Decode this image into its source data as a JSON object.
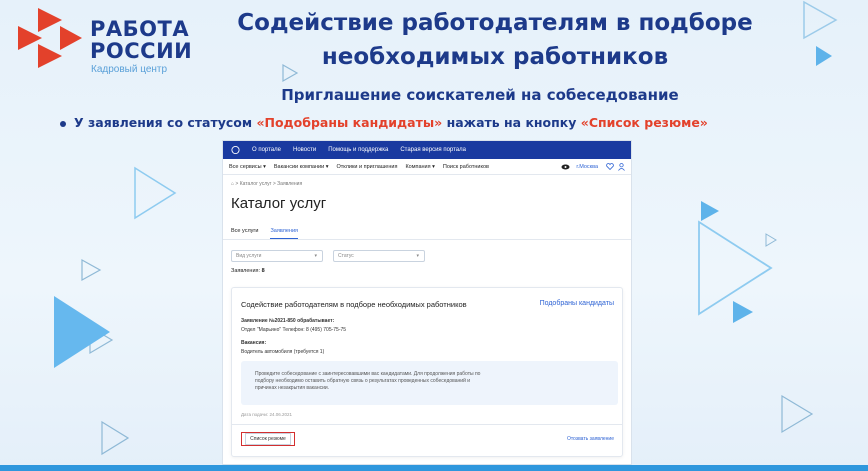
{
  "logo": {
    "line1": "РАБОТА",
    "line2": "РОССИИ",
    "sub": "Кадровый центр"
  },
  "title": "Содействие  работодателям в подборе необходимых работников",
  "subtitle": "Приглашение соискателей на собеседование",
  "instruction": {
    "prefix": "У заявления со статусом ",
    "status": "«Подобраны кандидаты»",
    "middle": " нажать на кнопку ",
    "button": "«Список резюме»"
  },
  "portal": {
    "topnav": [
      "О портале",
      "Новости",
      "Помощь и поддержка",
      "Старая версия портала"
    ],
    "menu": [
      "Все сервисы ▾",
      "Вакансии компании ▾",
      "Отклики и приглашения",
      "Компания ▾",
      "Поиск работников"
    ],
    "region": "г.Москва",
    "breadcrumb": "⌂  >  Каталог услуг  >  Заявления",
    "page_title": "Каталог услуг",
    "tabs": [
      "Все услуги",
      "Заявления"
    ],
    "filter_service_placeholder": "Вид услуги",
    "filter_status_placeholder": "Статус",
    "count_label": "Заявления: ",
    "count_value": "8",
    "card": {
      "title": "Содействие работодателям в подборе необходимых работников",
      "status": "Подобраны кандидаты",
      "app_label": "Заявление №2021-850 обрабатывает:",
      "app_value": "Отдел \"Марьино\" Телефон: 8 (495) 705-75-75",
      "vacancy_label": "Вакансия:",
      "vacancy_value": "Водитель автомобиля (требуется 1)",
      "notice_line1": "Проведите собеседование с заинтересовавшими вас кандидатами. Для продолжения работы по",
      "notice_line2": "подбору необходимо оставить обратную связь о результатах проведенных собеседований и",
      "notice_line3": "причинах незакрытия вакансии.",
      "date": "Дата подачи: 24.06.2021",
      "resume_button": "Список резюме",
      "cancel_link": "Отозвать заявление"
    }
  },
  "colors": {
    "navy": "#1d3a8a",
    "accent_red": "#e3412b",
    "portal_blue": "#1a3aa0",
    "link_blue": "#2e63d4",
    "bar_blue": "#2e97dd"
  }
}
